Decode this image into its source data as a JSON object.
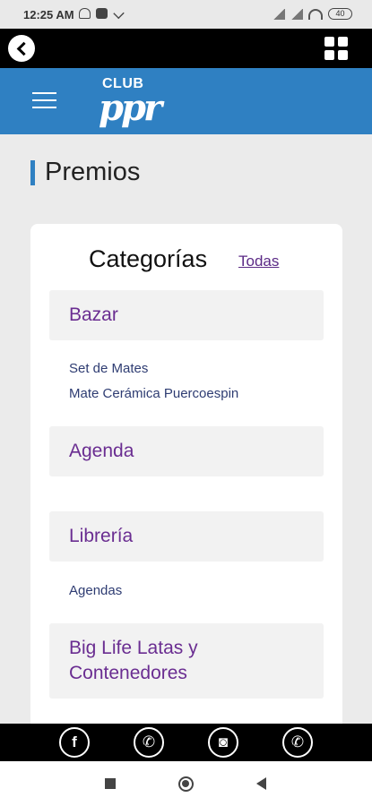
{
  "status_bar": {
    "time": "12:25 AM",
    "battery": "40"
  },
  "brand": {
    "logo_top": "CLUB",
    "logo_main": "ppr"
  },
  "page": {
    "title": "Premios"
  },
  "card": {
    "title": "Categorías",
    "all_link": "Todas",
    "categories": [
      {
        "title": "Bazar",
        "items": [
          "Set de Mates",
          "Mate Cerámica Puercoespin"
        ]
      },
      {
        "title": "Agenda",
        "items": []
      },
      {
        "title": "Librería",
        "items": [
          "Agendas"
        ]
      },
      {
        "title": "Big Life Latas y Contenedores",
        "title_line1": "Big Life Latas y",
        "title_line2": "Contenedores",
        "items": []
      }
    ]
  },
  "social": {
    "facebook_glyph": "f",
    "phone_glyph": "✆",
    "instagram_glyph": "◙",
    "whatsapp_glyph": "✆"
  },
  "colors": {
    "brand_blue": "#2f80c2",
    "category_purple": "#6a2d91",
    "link_purple": "#5b2a86",
    "item_blue": "#2e3c72"
  }
}
